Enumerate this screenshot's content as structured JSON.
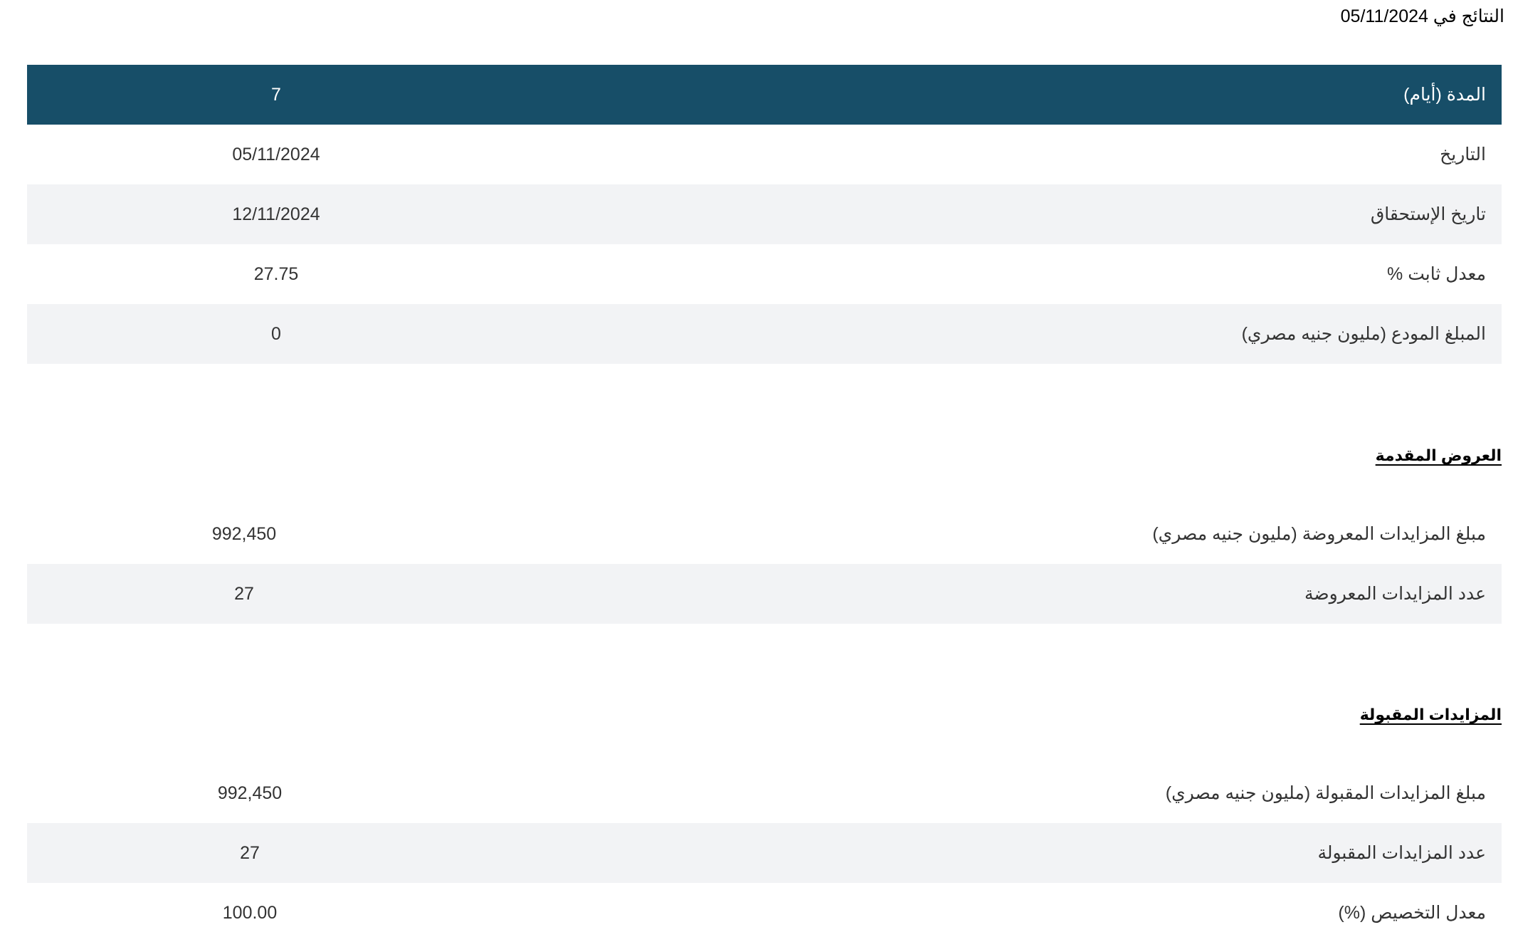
{
  "results": {
    "prefix": "النتائج في",
    "date": "05/11/2024"
  },
  "main_table": {
    "header": {
      "label": "المدة (أيام)",
      "value": "7"
    },
    "rows": [
      {
        "label": "التاريخ",
        "value": "05/11/2024"
      },
      {
        "label": "تاريخ الإستحقاق",
        "value": "12/11/2024"
      },
      {
        "label": "معدل ثابت %",
        "value": "27.75"
      },
      {
        "label": "المبلغ المودع (مليون جنيه مصري)",
        "value": "0"
      }
    ]
  },
  "offered": {
    "heading": "العروض المقدمة",
    "rows": [
      {
        "label": "مبلغ المزايدات المعروضة (مليون جنيه مصري)",
        "value": "992,450"
      },
      {
        "label": "عدد المزايدات المعروضة",
        "value": "27"
      }
    ]
  },
  "accepted": {
    "heading": "المزايدات المقبولة",
    "rows": [
      {
        "label": "مبلغ المزايدات المقبولة (مليون جنيه مصري)",
        "value": "992,450"
      },
      {
        "label": "عدد المزايدات المقبولة",
        "value": "27"
      },
      {
        "label": "معدل التخصيص (%)",
        "value": "100.00"
      }
    ]
  },
  "colors": {
    "header_bg": "#174e68",
    "header_text": "#ffffff",
    "shaded_row_bg": "#f2f3f5",
    "text": "#333333"
  }
}
